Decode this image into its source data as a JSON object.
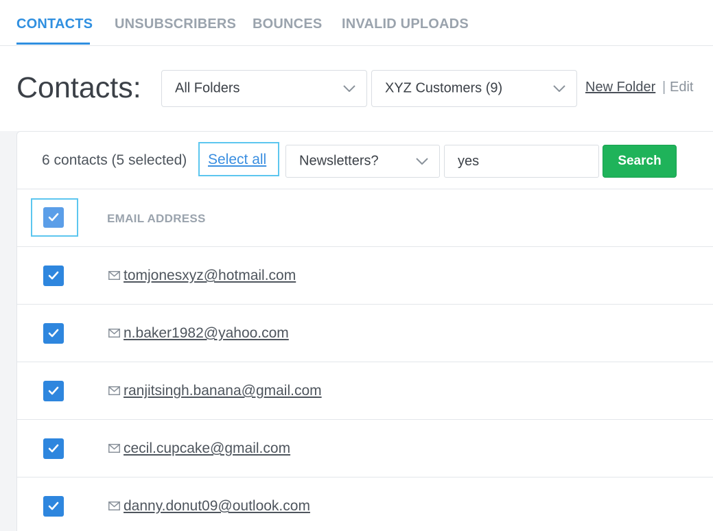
{
  "tabs": [
    {
      "label": "CONTACTS",
      "active": true
    },
    {
      "label": "UNSUBSCRIBERS",
      "active": false
    },
    {
      "label": "BOUNCES",
      "active": false
    },
    {
      "label": "INVALID UPLOADS",
      "active": false
    }
  ],
  "header": {
    "title": "Contacts:",
    "folder_select": "All Folders",
    "list_select": "XYZ Customers (9)",
    "new_folder_label": "New Folder",
    "separator": "|",
    "edit_label": "Edit"
  },
  "toolbar": {
    "count_text": "6 contacts (5 selected)",
    "select_all_label": "Select all",
    "field_select": "Newsletters?",
    "filter_value": "yes",
    "search_label": "Search"
  },
  "table": {
    "column_header": "EMAIL ADDRESS",
    "header_checked": true,
    "rows": [
      {
        "email": "tomjonesxyz@hotmail.com",
        "checked": true
      },
      {
        "email": "n.baker1982@yahoo.com",
        "checked": true
      },
      {
        "email": "ranjitsingh.banana@gmail.com",
        "checked": true
      },
      {
        "email": "cecil.cupcake@gmail.com",
        "checked": true
      },
      {
        "email": "danny.donut09@outlook.com",
        "checked": true
      }
    ]
  },
  "colors": {
    "accent": "#2f8fe0",
    "checkbox": "#2e86de",
    "search_button": "#1fb35a",
    "highlight_frame": "#5cc6ef"
  },
  "icons": {
    "dropdown": "chevron-down-icon",
    "checkbox": "checkmark-icon",
    "email": "envelope-icon"
  }
}
